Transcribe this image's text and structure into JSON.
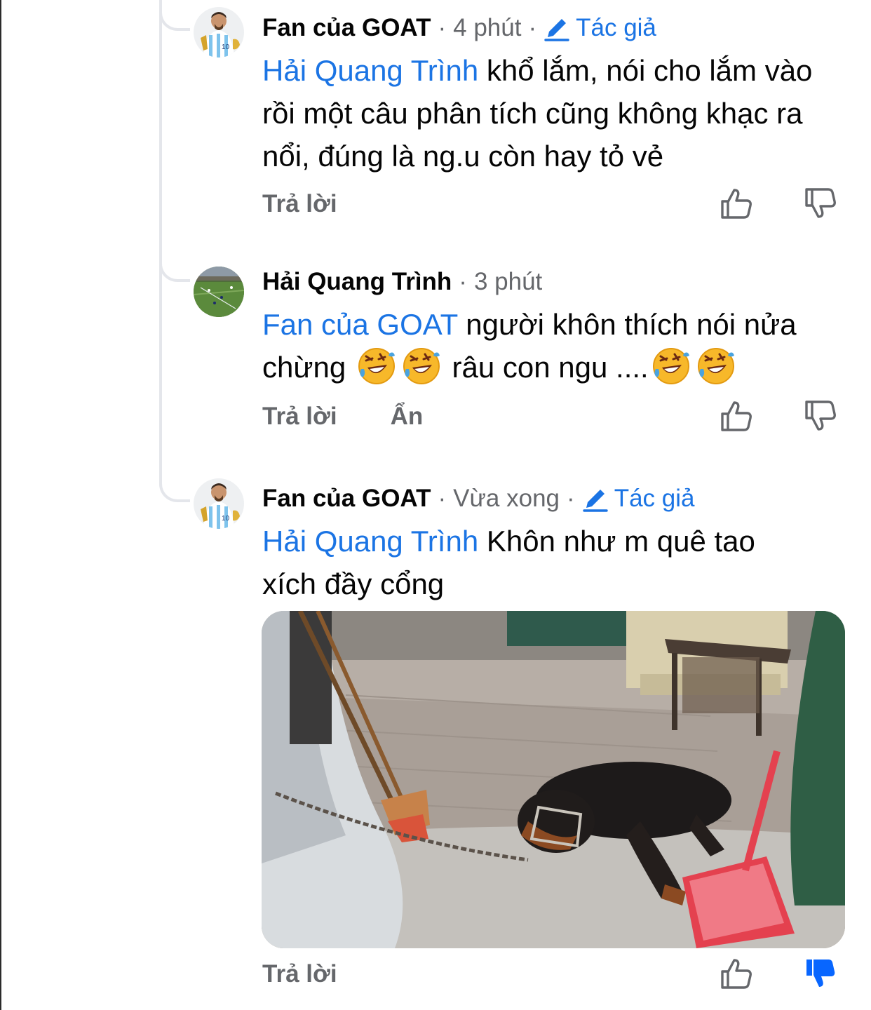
{
  "colors": {
    "link_blue": "#1b74e4",
    "secondary_text": "#65676b",
    "thread_line": "#e4e6eb",
    "dislike_active": "#0866ff"
  },
  "comments": [
    {
      "author": "Fan của GOAT",
      "time": "4 phút",
      "badge": "Tác giả",
      "mention": "Hải Quang Trình",
      "text": "khổ lắm, nói cho lắm vào rồi một câu phân tích cũng không khạc ra nổi, đúng là ng.u còn hay tỏ vẻ",
      "reply": "Trả lời",
      "icons": [
        "pencil-icon",
        "like-icon",
        "dislike-icon"
      ]
    },
    {
      "author": "Hải Quang Trình",
      "time": "3 phút",
      "mention": "Fan của GOAT",
      "text_part1": "người khôn thích nói nửa chừng",
      "text_part2": "râu con ngu ....",
      "emoji": "rolling-on-floor-laughing-emoji",
      "reply": "Trả lời",
      "hide": "Ẩn",
      "icons": [
        "like-icon",
        "dislike-icon"
      ]
    },
    {
      "author": "Fan của GOAT",
      "time": "Vừa xong",
      "badge": "Tác giả",
      "mention": "Hải Quang Trình",
      "text": "Khôn như m quê tao xích đầy cổng",
      "reply": "Trả lời",
      "dislike_active": true,
      "icons": [
        "pencil-icon",
        "like-icon",
        "dislike-filled-icon"
      ]
    }
  ]
}
